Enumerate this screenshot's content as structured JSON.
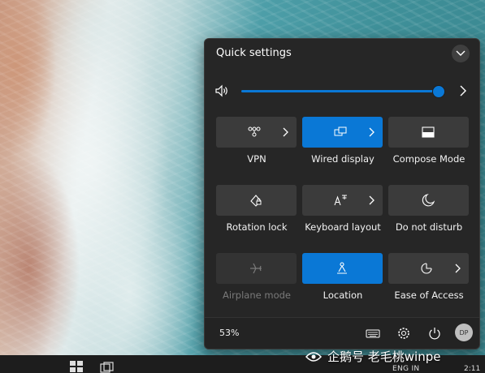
{
  "panel": {
    "title": "Quick settings"
  },
  "volume": {
    "level_percent": 100
  },
  "tiles": [
    {
      "label": "VPN",
      "icon": "vpn-icon",
      "state": "off",
      "has_chevron": true
    },
    {
      "label": "Wired display",
      "icon": "project-display-icon",
      "state": "on",
      "has_chevron": true
    },
    {
      "label": "Compose Mode",
      "icon": "compose-mode-icon",
      "state": "off",
      "has_chevron": false
    },
    {
      "label": "Rotation lock",
      "icon": "rotation-lock-icon",
      "state": "off",
      "has_chevron": false
    },
    {
      "label": "Keyboard layout",
      "icon": "keyboard-layout-icon",
      "state": "off",
      "has_chevron": true
    },
    {
      "label": "Do not disturb",
      "icon": "moon-icon",
      "state": "off",
      "has_chevron": false
    },
    {
      "label": "Airplane mode",
      "icon": "airplane-icon",
      "state": "disabled",
      "has_chevron": false
    },
    {
      "label": "Location",
      "icon": "location-icon",
      "state": "on",
      "has_chevron": false
    },
    {
      "label": "Ease of Access",
      "icon": "ease-of-access-icon",
      "state": "off",
      "has_chevron": true
    }
  ],
  "footer": {
    "battery": "53%",
    "avatar_initials": "DP"
  },
  "taskbar": {
    "tray_text": "ENG IN",
    "clock_text": "2:11"
  },
  "watermark": {
    "text": "企鹅号 老毛桃winpe"
  },
  "colors": {
    "accent": "#0a78d6",
    "panel_bg": "#262626",
    "tile_off": "#3b3b3b"
  }
}
